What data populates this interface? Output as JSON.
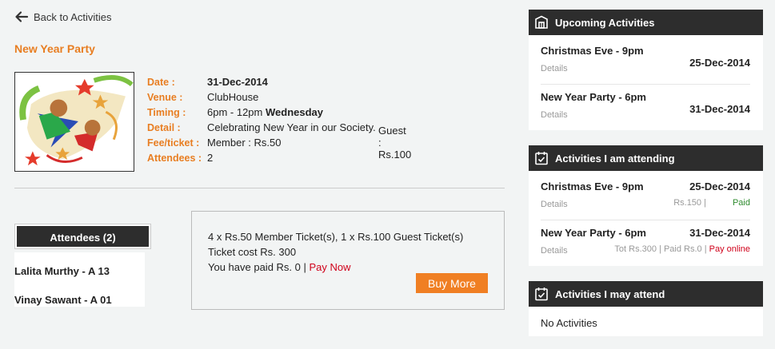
{
  "nav": {
    "back_label": "Back to Activities"
  },
  "event": {
    "title": "New Year Party",
    "labels": {
      "date": "Date :",
      "venue": "Venue :",
      "timing": "Timing :",
      "detail": "Detail :",
      "fee": "Fee/ticket :",
      "attendees": "Attendees :"
    },
    "date": "31-Dec-2014",
    "venue": "ClubHouse",
    "timing_hours": "6pm - 12pm",
    "timing_day": "Wednesday",
    "detail": "Celebrating New Year in our Society.",
    "fee_member": "Member : Rs.50",
    "fee_guest": "Guest : Rs.100",
    "attendee_count": "2"
  },
  "attendees": {
    "header": "Attendees (2)",
    "items": [
      "Lalita Murthy - A 13",
      "Vinay Sawant - A 01"
    ]
  },
  "ticket": {
    "line1": "4 x Rs.50 Member Ticket(s), 1 x Rs.100 Guest Ticket(s)",
    "line2": "Ticket cost Rs. 300",
    "line3_prefix": "You have paid Rs. 0 | ",
    "pay_now": "Pay Now",
    "buy_more": "Buy More"
  },
  "upcoming": {
    "title": "Upcoming Activities",
    "items": [
      {
        "name": "Christmas Eve - 9pm",
        "date": "25-Dec-2014",
        "link": "Details"
      },
      {
        "name": "New Year Party - 6pm",
        "date": "31-Dec-2014",
        "link": "Details"
      }
    ]
  },
  "attending": {
    "title": "Activities I am attending",
    "items": [
      {
        "name": "Christmas Eve - 9pm",
        "date": "25-Dec-2014",
        "link": "Details",
        "amount": "Rs.150 |",
        "status": "Paid"
      },
      {
        "name": "New Year Party - 6pm",
        "date": "31-Dec-2014",
        "link": "Details",
        "amount": "Tot Rs.300 | Paid Rs.0 |",
        "status": "Pay online"
      }
    ]
  },
  "may_attend": {
    "title": "Activities I may attend",
    "empty_text": "No Activities"
  },
  "icons": {
    "back": "arrow-left-icon",
    "upcoming": "building-icon",
    "attending": "calendar-check-icon",
    "may_attend": "calendar-check-icon"
  },
  "colors": {
    "accent": "#e87e22",
    "button": "#f07f23",
    "header_bg": "#2d2d2d",
    "link_red": "#d0021b",
    "paid_green": "#2e8b2e"
  }
}
